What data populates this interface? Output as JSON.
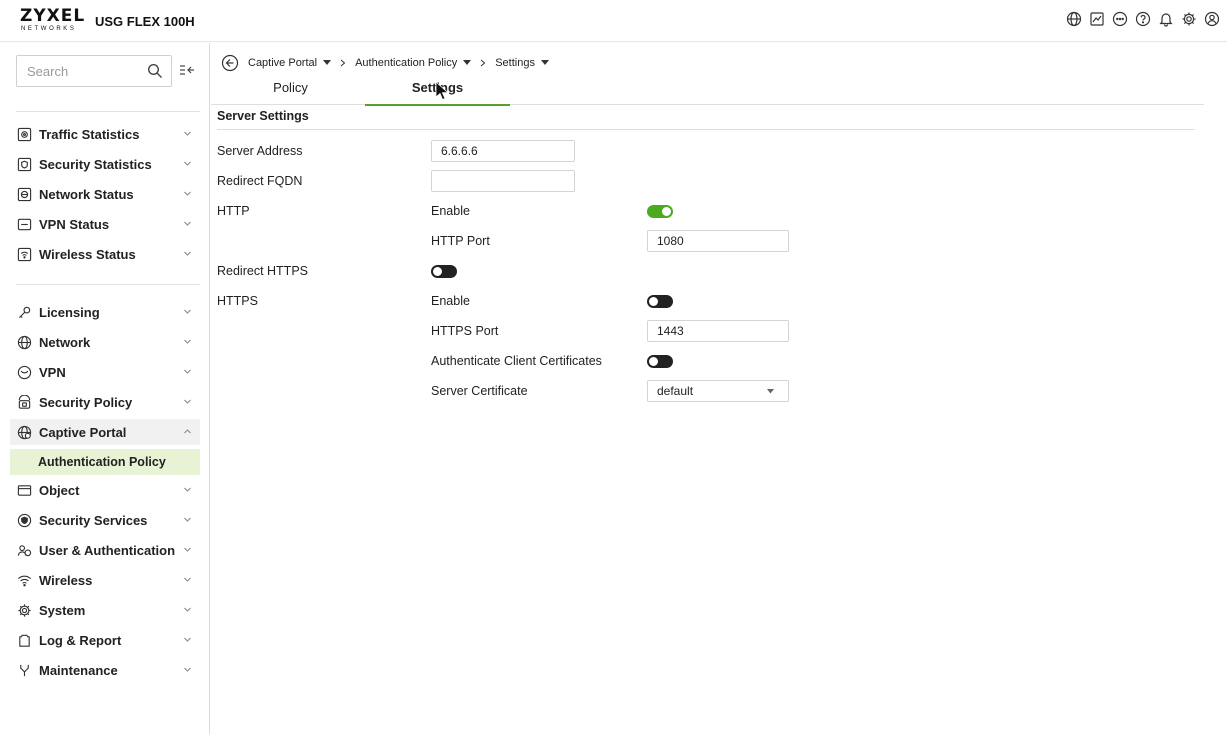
{
  "header": {
    "logo_main": "ZYXEL",
    "logo_sub": "NETWORKS",
    "device": "USG FLEX 100H",
    "icons": [
      "globe-icon",
      "chart-icon",
      "chat-icon",
      "help-icon",
      "bell-icon",
      "gear-icon",
      "user-icon"
    ]
  },
  "sidebar": {
    "search_placeholder": "Search",
    "monitor_items": [
      {
        "label": "Traffic Statistics",
        "icon": "traffic-icon"
      },
      {
        "label": "Security Statistics",
        "icon": "security-stats-icon"
      },
      {
        "label": "Network Status",
        "icon": "network-status-icon"
      },
      {
        "label": "VPN Status",
        "icon": "vpn-status-icon"
      },
      {
        "label": "Wireless Status",
        "icon": "wireless-status-icon"
      }
    ],
    "config_items": [
      {
        "label": "Licensing",
        "icon": "key-icon"
      },
      {
        "label": "Network",
        "icon": "globe-icon"
      },
      {
        "label": "VPN",
        "icon": "vpn-icon"
      },
      {
        "label": "Security Policy",
        "icon": "security-policy-icon"
      },
      {
        "label": "Captive Portal",
        "icon": "captive-portal-icon"
      },
      {
        "label": "Object",
        "icon": "object-icon"
      },
      {
        "label": "Security Services",
        "icon": "shield-icon"
      },
      {
        "label": "User & Authentication",
        "icon": "users-icon"
      },
      {
        "label": "Wireless",
        "icon": "wifi-icon"
      },
      {
        "label": "System",
        "icon": "gear-icon"
      },
      {
        "label": "Log & Report",
        "icon": "clipboard-icon"
      },
      {
        "label": "Maintenance",
        "icon": "tools-icon"
      }
    ],
    "sub_item": "Authentication Policy"
  },
  "breadcrumb": {
    "items": [
      "Captive Portal",
      "Authentication Policy",
      "Settings"
    ]
  },
  "tabs": [
    "Policy",
    "Settings"
  ],
  "active_tab": "Settings",
  "section": {
    "title": "Server Settings",
    "server_address_label": "Server Address",
    "server_address_value": "6.6.6.6",
    "redirect_fqdn_label": "Redirect FQDN",
    "redirect_fqdn_value": "",
    "http_label": "HTTP",
    "http_enable_label": "Enable",
    "http_enabled": true,
    "http_port_label": "HTTP Port",
    "http_port_value": "1080",
    "redirect_https_label": "Redirect HTTPS",
    "redirect_https_enabled": false,
    "https_label": "HTTPS",
    "https_enable_label": "Enable",
    "https_enabled": false,
    "https_port_label": "HTTPS Port",
    "https_port_value": "1443",
    "auth_client_cert_label": "Authenticate Client Certificates",
    "auth_client_cert_enabled": false,
    "server_cert_label": "Server Certificate",
    "server_cert_value": "default"
  },
  "colors": {
    "accent_green": "#5aa02c",
    "toggle_on": "#4caa1f",
    "selected_sub_bg": "#e8f3d6"
  }
}
